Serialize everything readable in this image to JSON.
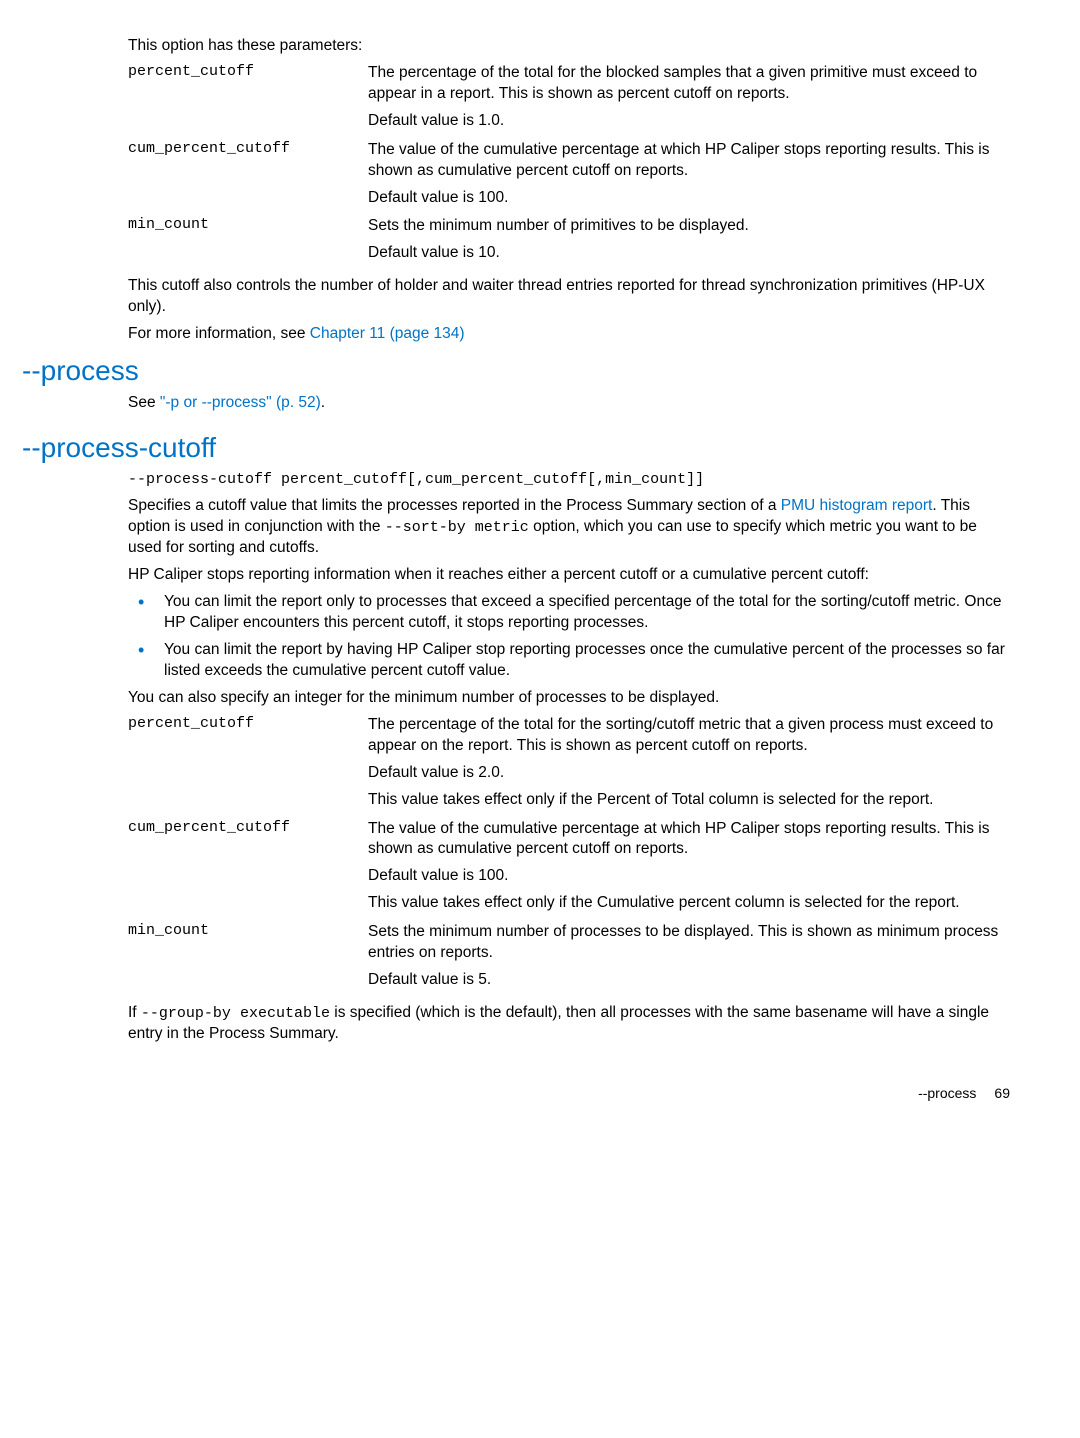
{
  "s1": {
    "intro": "This option has these parameters:",
    "params": {
      "percent_cutoff": {
        "term": "percent_cutoff",
        "l1": "The percentage of the total for the blocked samples that a given primitive must exceed to appear in a report. This is shown as percent cutoff on reports.",
        "l2": "Default value is 1.0."
      },
      "cum_percent_cutoff": {
        "term": "cum_percent_cutoff",
        "l1": "The value of the cumulative percentage at which HP Caliper stops reporting results. This is shown as cumulative percent cutoff on reports.",
        "l2": "Default value is 100."
      },
      "min_count": {
        "term": "min_count",
        "l1": "Sets the minimum number of primitives to be displayed.",
        "l2": "Default value is 10."
      }
    },
    "note": "This cutoff also controls the number of holder and waiter thread entries reported for thread synchronization primitives (HP-UX only).",
    "moreinfo_pre": "For more information, see ",
    "moreinfo_link": "Chapter 11 (page 134)"
  },
  "process": {
    "heading": "--process",
    "see_pre": "See ",
    "see_link": "\"-p or --process\" (p. 52)",
    "see_post": "."
  },
  "pc": {
    "heading": "--process-cutoff",
    "syntax": "--process-cutoff percent_cutoff[,cum_percent_cutoff[,min_count]]",
    "p1_pre": "Specifies a cutoff value that limits the processes reported in the Process Summary section of a ",
    "p1_link": "PMU histogram report",
    "p1_mid": ". This option is used in conjunction with the ",
    "p1_code": "--sort-by metric",
    "p1_post": " option, which you can use to specify which metric you want to be used for sorting and cutoffs.",
    "p2": "HP Caliper stops reporting information when it reaches either a percent cutoff or a cumulative percent cutoff:",
    "b1": "You can limit the report only to processes that exceed a specified percentage of the total for the sorting/cutoff metric. Once HP Caliper encounters this percent cutoff, it stops reporting processes.",
    "b2": "You can limit the report by having HP Caliper stop reporting processes once the cumulative percent of the processes so far listed exceeds the cumulative percent cutoff value.",
    "p3": "You can also specify an integer for the minimum number of processes to be displayed.",
    "params": {
      "percent_cutoff": {
        "term": "percent_cutoff",
        "l1": "The percentage of the total for the sorting/cutoff metric that a given process must exceed to appear on the report. This is shown as percent cutoff on reports.",
        "l2": "Default value is 2.0.",
        "l3": "This value takes effect only if the Percent of Total column is selected for the report."
      },
      "cum_percent_cutoff": {
        "term": "cum_percent_cutoff",
        "l1": "The value of the cumulative percentage at which HP Caliper stops reporting results. This is shown as cumulative percent cutoff on reports.",
        "l2": "Default value is 100.",
        "l3": "This value takes effect only if the Cumulative percent column is selected for the report."
      },
      "min_count": {
        "term": "min_count",
        "l1": "Sets the minimum number of processes to be displayed. This is shown as minimum process entries on reports.",
        "l2": "Default value is 5."
      }
    },
    "trail_pre": "If ",
    "trail_code": "--group-by executable",
    "trail_post": " is specified (which is the default), then all processes with the same basename will have a single entry in the Process Summary."
  },
  "footer": {
    "section": "--process",
    "page": "69"
  }
}
